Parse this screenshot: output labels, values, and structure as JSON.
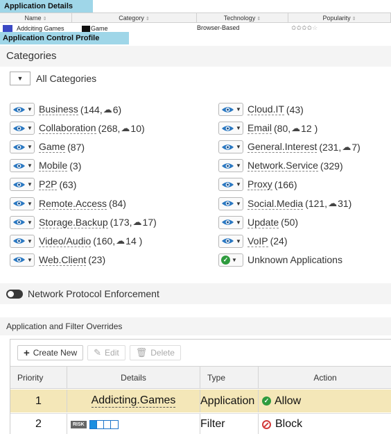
{
  "details": {
    "header": "Application Details",
    "columns": [
      "Name",
      "Category",
      "Technology",
      "Popularity"
    ],
    "row": {
      "name": "Addciting Games",
      "category": "Game",
      "technology": "Browser-Based",
      "popularity_stars": 4,
      "popularity_max": 5
    }
  },
  "profile_header": "Application Control Profile",
  "categories": {
    "title": "Categories",
    "all_label": "All Categories",
    "items": [
      {
        "label": "Business",
        "count": "(144, ",
        "cloud": "6)"
      },
      {
        "label": "Cloud.IT",
        "count": "(43)",
        "cloud": ""
      },
      {
        "label": "Collaboration",
        "count": "(268, ",
        "cloud": "10)"
      },
      {
        "label": "Email",
        "count": "(80, ",
        "cloud": "12 )"
      },
      {
        "label": "Game",
        "count": "(87)",
        "cloud": ""
      },
      {
        "label": "General.Interest",
        "count": "(231, ",
        "cloud": "7)"
      },
      {
        "label": "Mobile",
        "count": "(3)",
        "cloud": ""
      },
      {
        "label": "Network.Service",
        "count": "(329)",
        "cloud": ""
      },
      {
        "label": "P2P",
        "count": "(63)",
        "cloud": ""
      },
      {
        "label": "Proxy",
        "count": "(166)",
        "cloud": ""
      },
      {
        "label": "Remote.Access",
        "count": "(84)",
        "cloud": ""
      },
      {
        "label": "Social.Media",
        "count": "(121, ",
        "cloud": "31)"
      },
      {
        "label": "Storage.Backup",
        "count": "(173, ",
        "cloud": "17)"
      },
      {
        "label": "Update",
        "count": "(50)",
        "cloud": ""
      },
      {
        "label": "Video/Audio",
        "count": "(160, ",
        "cloud": "14 )"
      },
      {
        "label": "VoIP",
        "count": "(24)",
        "cloud": ""
      },
      {
        "label": "Web.Client",
        "count": "(23)",
        "cloud": ""
      },
      {
        "label": "Unknown Applications",
        "count": "",
        "cloud": ""
      }
    ]
  },
  "network_protocol": {
    "label": "Network Protocol Enforcement",
    "enabled": false
  },
  "overrides": {
    "title": "Application and Filter Overrides",
    "toolbar": {
      "create": "Create New",
      "edit": "Edit",
      "delete": "Delete"
    },
    "columns": {
      "priority": "Priority",
      "details": "Details",
      "type": "Type",
      "action": "Action"
    },
    "rows": [
      {
        "priority": "1",
        "details": "Addicting.Games",
        "type": "Application",
        "action": "Allow"
      },
      {
        "priority": "2",
        "risk_label": "RISK",
        "risk_level": 1,
        "risk_max": 4,
        "type": "Filter",
        "action": "Block"
      }
    ]
  },
  "colors": {
    "header_accent": "#9fd6e8",
    "allow": "#2e9b3e",
    "block": "#d23b3b",
    "highlight_row": "#f4e7b8"
  }
}
